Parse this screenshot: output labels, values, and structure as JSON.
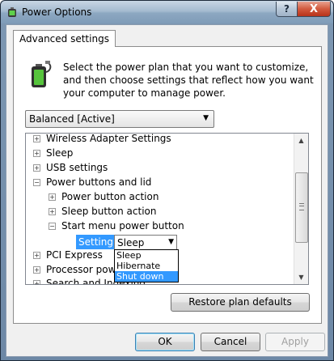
{
  "window": {
    "title": "Power Options",
    "help_glyph": "?",
    "close_glyph": "X"
  },
  "tab": {
    "label": "Advanced settings"
  },
  "description": "Select the power plan that you want to customize, and then choose settings that reflect how you want your computer to manage power.",
  "plan_select": {
    "value": "Balanced [Active]"
  },
  "tree": {
    "items": [
      {
        "label": "Wireless Adapter Settings",
        "expander": "+"
      },
      {
        "label": "Sleep",
        "expander": "+"
      },
      {
        "label": "USB settings",
        "expander": "+"
      },
      {
        "label": "Power buttons and lid",
        "expander": "−"
      },
      {
        "label": "Power button action",
        "expander": "+"
      },
      {
        "label": "Sleep button action",
        "expander": "+"
      },
      {
        "label": "Start menu power button",
        "expander": "−"
      },
      {
        "label": "PCI Express",
        "expander": "+"
      },
      {
        "label": "Processor power",
        "expander": "+"
      },
      {
        "label": "Search and Indexing",
        "expander": "+"
      }
    ],
    "setting_label": "Setting:",
    "setting_value": "Sleep",
    "dropdown_options": [
      "Sleep",
      "Hibernate",
      "Shut down"
    ]
  },
  "buttons": {
    "restore": "Restore plan defaults",
    "ok": "OK",
    "cancel": "Cancel",
    "apply": "Apply"
  },
  "colors": {
    "selection": "#3399ff",
    "title_gradient": "#9fb6cc",
    "close": "#d25a3f"
  }
}
